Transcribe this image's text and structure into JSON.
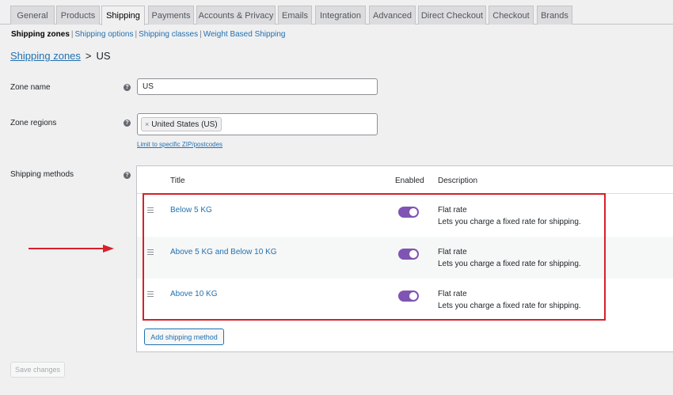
{
  "tabs": [
    "General",
    "Products",
    "Shipping",
    "Payments",
    "Accounts & Privacy",
    "Emails",
    "Integration",
    "Advanced",
    "Direct Checkout",
    "Checkout",
    "Brands"
  ],
  "active_tab": "Shipping",
  "subnav": {
    "current": "Shipping zones",
    "links": [
      "Shipping options",
      "Shipping classes",
      "Weight Based Shipping"
    ]
  },
  "breadcrumb": {
    "link": "Shipping zones",
    "separator": ">",
    "current": "US"
  },
  "zone_name": {
    "label": "Zone name",
    "value": "US"
  },
  "zone_regions": {
    "label": "Zone regions",
    "chip_remove": "×",
    "chip": "United States (US)",
    "limit_link": "Limit to specific ZIP/postcodes"
  },
  "shipping_methods": {
    "label": "Shipping methods",
    "headers": {
      "title": "Title",
      "enabled": "Enabled",
      "description": "Description"
    },
    "rows": [
      {
        "title": "Below 5 KG",
        "enabled": true,
        "desc_title": "Flat rate",
        "desc": "Lets you charge a fixed rate for shipping."
      },
      {
        "title": "Above 5 KG and Below 10 KG",
        "enabled": true,
        "desc_title": "Flat rate",
        "desc": "Lets you charge a fixed rate for shipping."
      },
      {
        "title": "Above 10 KG",
        "enabled": true,
        "desc_title": "Flat rate",
        "desc": "Lets you charge a fixed rate for shipping."
      }
    ],
    "add_button": "Add shipping method"
  },
  "save_button": "Save changes",
  "help_glyph": "?",
  "icons": {
    "help": "help-icon",
    "drag": "drag-handle-icon",
    "toggle": "toggle-on-icon",
    "arrow": "red-arrow-icon"
  },
  "colors": {
    "link": "#2271b1",
    "toggle": "#7f54b3",
    "highlight": "#d6202a"
  }
}
